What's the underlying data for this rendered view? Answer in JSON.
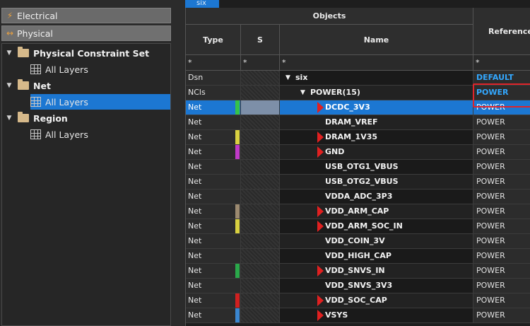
{
  "left_panel": {
    "tabs": [
      {
        "label": "Electrical",
        "icon": "lightning-icon"
      },
      {
        "label": "Physical",
        "icon": "physical-arrows-icon"
      }
    ],
    "tree": [
      {
        "label": "Physical Constraint Set",
        "child": "All Layers"
      },
      {
        "label": "Net",
        "child": "All Layers"
      },
      {
        "label": "Region",
        "child": "All Layers"
      }
    ]
  },
  "doc_tab": "six",
  "table": {
    "group_header": "Objects",
    "headers": {
      "type": "Type",
      "s": "S",
      "name": "Name",
      "referenced": "Referenced"
    },
    "filter": {
      "type": "*",
      "s": "*",
      "name": "*",
      "ref": "*"
    },
    "rows": [
      {
        "type": "Dsn",
        "name": "six",
        "ref": "DEFAULT",
        "ref_style": "blue",
        "indent": 0,
        "expand": true,
        "swatch": "",
        "marker": false
      },
      {
        "type": "NCls",
        "name": "POWER(15)",
        "ref": "POWER",
        "ref_style": "blue",
        "indent": 1,
        "expand": true,
        "swatch": "",
        "marker": false
      },
      {
        "type": "Net",
        "name": "DCDC_3V3",
        "ref": "POWER",
        "selected": true,
        "swatch": "#35c24a",
        "marker": true
      },
      {
        "type": "Net",
        "name": "DRAM_VREF",
        "ref": "POWER",
        "swatch": "",
        "marker": false
      },
      {
        "type": "Net",
        "name": "DRAM_1V35",
        "ref": "POWER",
        "swatch": "#d8d040",
        "marker": true
      },
      {
        "type": "Net",
        "name": "GND",
        "ref": "POWER",
        "swatch": "#c03ac8",
        "marker": true
      },
      {
        "type": "Net",
        "name": "USB_OTG1_VBUS",
        "ref": "POWER",
        "swatch": "",
        "marker": false
      },
      {
        "type": "Net",
        "name": "USB_OTG2_VBUS",
        "ref": "POWER",
        "swatch": "",
        "marker": false
      },
      {
        "type": "Net",
        "name": "VDDA_ADC_3P3",
        "ref": "POWER",
        "swatch": "",
        "marker": false
      },
      {
        "type": "Net",
        "name": "VDD_ARM_CAP",
        "ref": "POWER",
        "swatch": "#9c8a70",
        "marker": true
      },
      {
        "type": "Net",
        "name": "VDD_ARM_SOC_IN",
        "ref": "POWER",
        "swatch": "#d8d040",
        "marker": true
      },
      {
        "type": "Net",
        "name": "VDD_COIN_3V",
        "ref": "POWER",
        "swatch": "",
        "marker": false
      },
      {
        "type": "Net",
        "name": "VDD_HIGH_CAP",
        "ref": "POWER",
        "swatch": "",
        "marker": false
      },
      {
        "type": "Net",
        "name": "VDD_SNVS_IN",
        "ref": "POWER",
        "swatch": "#2aa84a",
        "marker": true
      },
      {
        "type": "Net",
        "name": "VDD_SNVS_3V3",
        "ref": "POWER",
        "swatch": "",
        "marker": false
      },
      {
        "type": "Net",
        "name": "VDD_SOC_CAP",
        "ref": "POWER",
        "swatch": "#d02020",
        "marker": true
      },
      {
        "type": "Net",
        "name": "VSYS",
        "ref": "POWER",
        "swatch": "#3a86d0",
        "marker": true
      }
    ]
  }
}
